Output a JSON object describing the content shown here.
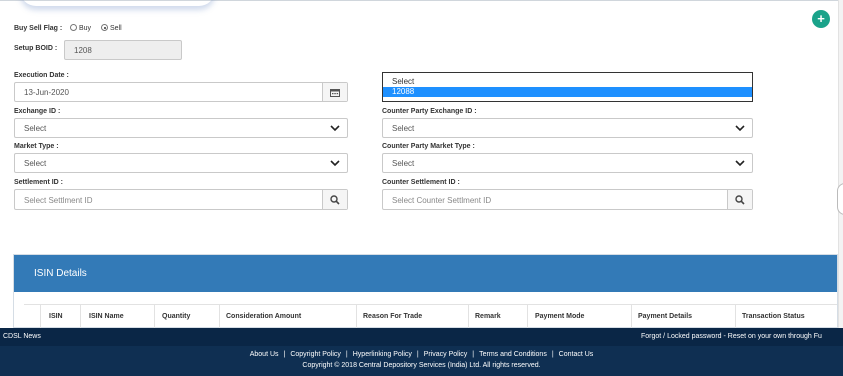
{
  "form": {
    "buy_sell_label": "Buy Sell Flag :",
    "buy_label": "Buy",
    "sell_label": "Sell",
    "selected_flag": "Sell",
    "setup_boid_label": "Setup BOID :",
    "setup_boid_value": "1208",
    "execution_date_label": "Execution Date :",
    "execution_date_value": "13-Jun-2020",
    "exchange_id_label": "Exchange ID :",
    "exchange_id_value": "Select",
    "market_type_label": "Market Type :",
    "market_type_value": "Select",
    "settlement_id_label": "Settlement ID :",
    "settlement_id_placeholder": "Select Settlment ID",
    "counterparty_dropdown": {
      "options": [
        "Select",
        "12088"
      ],
      "highlighted": "12088"
    },
    "cp_exchange_id_label": "Counter Party Exchange ID :",
    "cp_exchange_id_value": "Select",
    "cp_market_type_label": "Counter Party Market Type :",
    "cp_market_type_value": "Select",
    "cp_settlement_id_label": "Counter Settlement ID :",
    "cp_settlement_id_placeholder": "Select Counter Settlment ID"
  },
  "isin": {
    "title": "ISIN Details",
    "add_label": "+",
    "columns": [
      "ISIN",
      "ISIN Name",
      "Quantity",
      "Consideration Amount",
      "Reason For Trade",
      "Remark",
      "Payment Mode",
      "Payment Details",
      "Transaction Status"
    ]
  },
  "footer": {
    "news_label": "CDSL News",
    "marquee_text": "Forgot / Locked password - Reset on your own through Fu",
    "links": [
      "About Us",
      "Copyright Policy",
      "Hyperlinking Policy",
      "Privacy Policy",
      "Terms and Conditions",
      "Contact Us"
    ],
    "separator": "|",
    "copyright": "Copyright © 2018 Central Depository Services (India) Ltd. All rights reserved."
  },
  "icons": {
    "calendar": "calendar-icon",
    "search": "search-icon",
    "chevron": "chevron-down-icon",
    "add": "plus-icon"
  },
  "colors": {
    "panel_header": "#337ab7",
    "footer_bg": "#0f2f52",
    "add_button": "#1aa38a",
    "selected_option": "#1e90ff"
  }
}
